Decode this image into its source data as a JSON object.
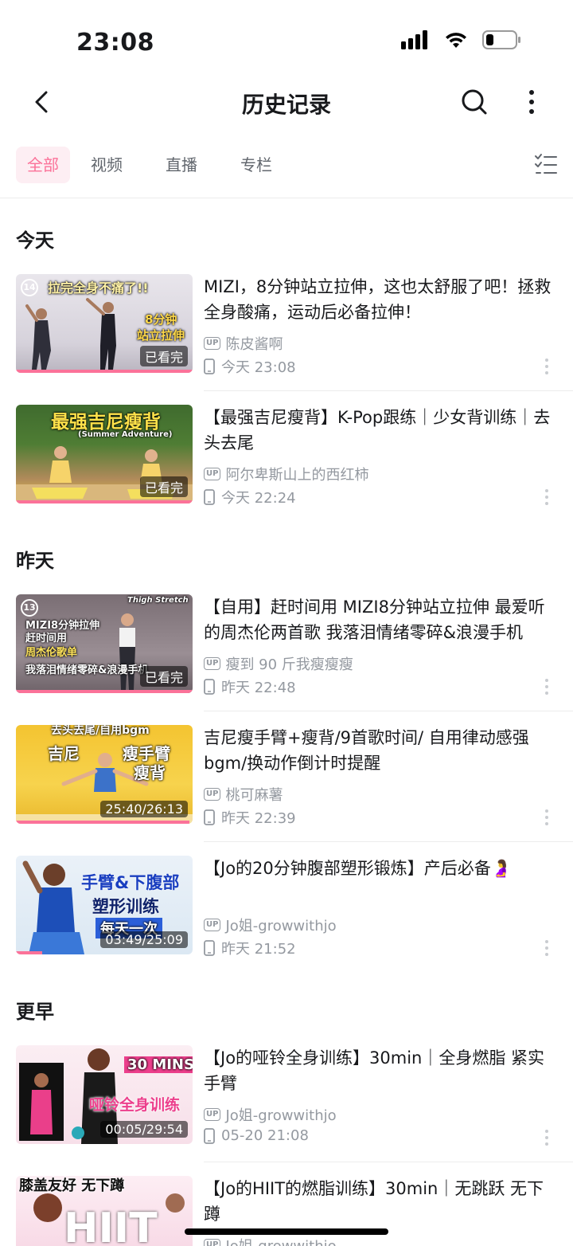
{
  "status": {
    "time": "23:08"
  },
  "nav": {
    "title": "历史记录"
  },
  "tabs": [
    {
      "label": "全部",
      "active": true
    },
    {
      "label": "视频",
      "active": false
    },
    {
      "label": "直播",
      "active": false
    },
    {
      "label": "专栏",
      "active": false
    }
  ],
  "sections": {
    "today": "今天",
    "yesterday": "昨天",
    "earlier": "更早"
  },
  "items": [
    {
      "title": "MIZI，8分钟站立拉伸，这也太舒服了吧！拯救全身酸痛，运动后必备拉伸！",
      "up": "陈皮酱啊",
      "time": "今天 23:08",
      "badge": "已看完",
      "thumb_captions": [
        "拉完全身不痛了!!",
        "8分钟",
        "站立拉伸",
        "14"
      ],
      "progress": 1.0
    },
    {
      "title": "【最强吉尼瘦背】K-Pop跟练｜少女背训练｜去头去尾",
      "up": "阿尔卑斯山上的西红柿",
      "time": "今天 22:24",
      "badge": "已看完",
      "thumb_captions": [
        "最强吉尼瘦背",
        "(Summer Adventure)"
      ],
      "progress": 1.0
    },
    {
      "title": "【自用】赶时间用 MIZI8分钟站立拉伸  最爱听的周杰伦两首歌 我落泪情绪零碎&浪漫手机",
      "up": "瘦到 90 斤我瘦瘦瘦",
      "time": "昨天 22:48",
      "badge": "已看完",
      "thumb_captions": [
        "MIZI8分钟拉伸",
        "赶时间用",
        "周杰伦歌单",
        "我落泪情绪零碎&浪漫手机",
        "13",
        "Thigh Stretch"
      ],
      "progress": 1.0
    },
    {
      "title": "吉尼瘦手臂+瘦背/9首歌时间/ 自用律动感强bgm/换动作倒计时提醒",
      "up": "桃可麻薯",
      "time": "昨天 22:39",
      "badge": "25:40/26:13",
      "thumb_captions": [
        "去头去尾/自用bgm",
        "吉尼",
        "瘦手臂",
        "瘦背"
      ],
      "progress": 0.98
    },
    {
      "title": "【Jo的20分钟腹部塑形锻炼】产后必备🤰",
      "up": "Jo姐-growwithjo",
      "time": "昨天 21:52",
      "badge": "03:49/25:09",
      "thumb_captions": [
        "手臂&下腹部",
        "塑形训练",
        "每天一次"
      ],
      "progress": 0.15
    },
    {
      "title": "【Jo的哑铃全身训练】30min｜全身燃脂 紧实手臂",
      "up": "Jo姐-growwithjo",
      "time": "05-20 21:08",
      "badge": "00:05/29:54",
      "thumb_captions": [
        "30 MINS",
        "哑铃全身训练"
      ],
      "progress": 0.01
    },
    {
      "title": "【Jo的HIIT的燃脂训练】30min｜无跳跃 无下蹲",
      "up": "Jo姐-growwithjo",
      "time": "",
      "badge": "",
      "thumb_captions": [
        "膝盖友好 无下蹲",
        "HIIT"
      ],
      "progress": 0
    }
  ],
  "colors": {
    "accent": "#fb7299",
    "secondary_text": "#9499a0"
  }
}
